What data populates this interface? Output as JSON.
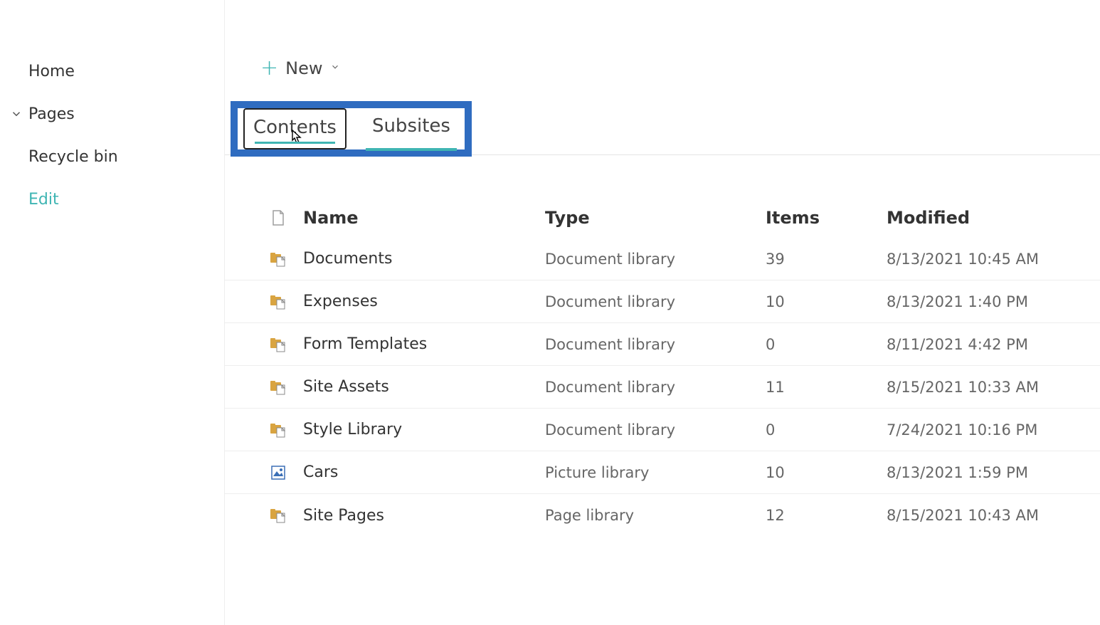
{
  "sidebar": {
    "items": [
      {
        "label": "Home"
      },
      {
        "label": "Pages",
        "expandable": true
      },
      {
        "label": "Recycle bin"
      }
    ],
    "edit_label": "Edit"
  },
  "toolbar": {
    "new_label": "New"
  },
  "tabs": {
    "contents": "Contents",
    "subsites": "Subsites"
  },
  "table": {
    "headers": {
      "name": "Name",
      "type": "Type",
      "items": "Items",
      "modified": "Modified"
    },
    "rows": [
      {
        "icon": "doclib",
        "name": "Documents",
        "type": "Document library",
        "items": "39",
        "modified": "8/13/2021 10:45 AM"
      },
      {
        "icon": "doclib",
        "name": "Expenses",
        "type": "Document library",
        "items": "10",
        "modified": "8/13/2021 1:40 PM"
      },
      {
        "icon": "doclib",
        "name": "Form Templates",
        "type": "Document library",
        "items": "0",
        "modified": "8/11/2021 4:42 PM"
      },
      {
        "icon": "doclib",
        "name": "Site Assets",
        "type": "Document library",
        "items": "11",
        "modified": "8/15/2021 10:33 AM"
      },
      {
        "icon": "doclib",
        "name": "Style Library",
        "type": "Document library",
        "items": "0",
        "modified": "7/24/2021 10:16 PM"
      },
      {
        "icon": "piclib",
        "name": "Cars",
        "type": "Picture library",
        "items": "10",
        "modified": "8/13/2021 1:59 PM"
      },
      {
        "icon": "doclib",
        "name": "Site Pages",
        "type": "Page library",
        "items": "12",
        "modified": "8/15/2021 10:43 AM"
      }
    ]
  }
}
